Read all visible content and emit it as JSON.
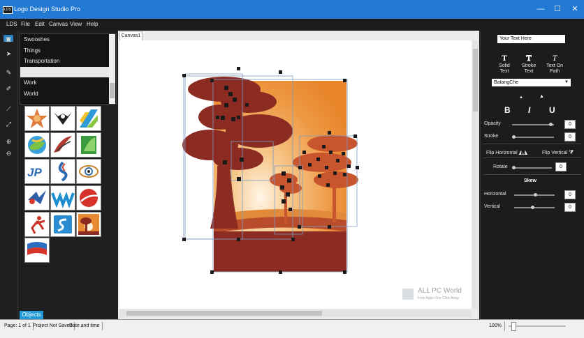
{
  "titlebar": {
    "title": "Logo Design Studio Pro",
    "min": "—",
    "max": "☐",
    "close": "✕"
  },
  "menu": [
    "LDS",
    "File",
    "Edit",
    "Canvas",
    "View",
    "Help"
  ],
  "categories": [
    "Swooshes",
    "Things",
    "Transportation",
    "",
    "Work",
    "World"
  ],
  "objects_tab": "Objects",
  "canvas_tab": "Canvas1",
  "right": {
    "text_input": "Your Text Here",
    "text_modes": [
      {
        "icon": "T",
        "label": "Solid Text"
      },
      {
        "icon": "T",
        "label": "Stroke Text"
      },
      {
        "icon": "T",
        "label": "Text On Path"
      }
    ],
    "font": "BatangChe",
    "styles": [
      "B",
      "I",
      "U"
    ],
    "opacity_label": "Opacity",
    "opacity_value": "0",
    "stroke_label": "Stroke",
    "stroke_value": "0",
    "flip_h": "Flip Horizontal",
    "flip_v": "Flip Vertical",
    "rotate_label": "Rotate",
    "rotate_value": "0",
    "skew_title": "Skew",
    "skew_h_label": "Horizontal",
    "skew_h_value": "0",
    "skew_v_label": "Vertical",
    "skew_v_value": "0"
  },
  "status": {
    "page": "Page: 1 of 1",
    "project": "Project Not Saved",
    "datetime": "Date and time",
    "zoom": "100%"
  },
  "watermark": {
    "brand": "ALL PC World",
    "tagline": "Free Apps One Click Away"
  },
  "colors": {
    "titlebar": "#2279d3",
    "accent": "#1f9bd7",
    "tree": "#8c2b22",
    "sky_top": "#e8852a",
    "sky_glow": "#fff6e8"
  }
}
